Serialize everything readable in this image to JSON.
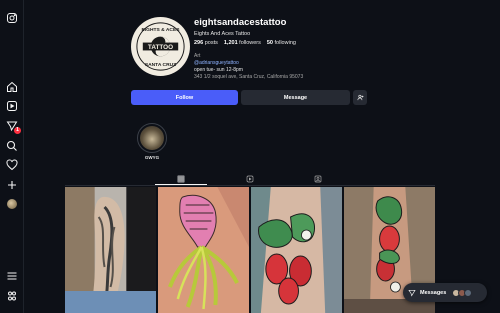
{
  "profile": {
    "username": "eightsandacestattoo",
    "full_name": "Eights And Aces Tattoo",
    "stats": {
      "posts_count": "296",
      "posts_label": "posts",
      "followers_count": "1,201",
      "followers_label": "followers",
      "following_count": "50",
      "following_label": "following"
    },
    "category": "Art",
    "handle_link": "@adriansgueytattoo",
    "hours": "open tue- sun 12-8pm",
    "address": "343 1/2 soquel ave, Santa Cruz, California 95073",
    "logo_text": {
      "top": "EIGHTS & ACES",
      "middle": "TATTOO",
      "bottom": "SANTA CRUZ"
    }
  },
  "buttons": {
    "follow": "Follow",
    "message": "Message"
  },
  "highlights": [
    {
      "label": "GWYG"
    }
  ],
  "messages_pill": {
    "label": "Messages"
  },
  "icons": {
    "rail": [
      "instagram-icon",
      "home-icon",
      "reels-icon",
      "messages-icon",
      "search-icon",
      "notifications-icon",
      "create-icon",
      "profile-icon",
      "menu-icon",
      "threads-icon"
    ],
    "tabs": [
      "grid-icon",
      "reels-icon",
      "tagged-icon"
    ]
  },
  "notifications": {
    "messages_badge": "1"
  },
  "colors": {
    "accent": "#4a5df9",
    "background": "#0d1017",
    "badge": "#ff3040"
  }
}
